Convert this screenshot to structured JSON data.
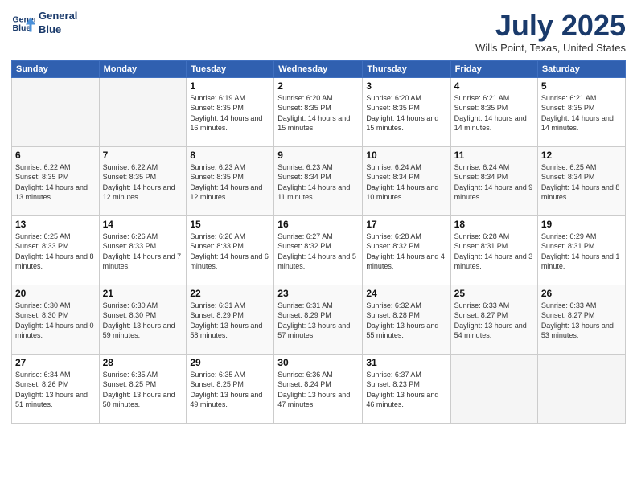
{
  "header": {
    "logo_line1": "General",
    "logo_line2": "Blue",
    "month_title": "July 2025",
    "location": "Wills Point, Texas, United States"
  },
  "weekdays": [
    "Sunday",
    "Monday",
    "Tuesday",
    "Wednesday",
    "Thursday",
    "Friday",
    "Saturday"
  ],
  "weeks": [
    [
      {
        "day": "",
        "info": ""
      },
      {
        "day": "",
        "info": ""
      },
      {
        "day": "1",
        "info": "Sunrise: 6:19 AM\nSunset: 8:35 PM\nDaylight: 14 hours and 16 minutes."
      },
      {
        "day": "2",
        "info": "Sunrise: 6:20 AM\nSunset: 8:35 PM\nDaylight: 14 hours and 15 minutes."
      },
      {
        "day": "3",
        "info": "Sunrise: 6:20 AM\nSunset: 8:35 PM\nDaylight: 14 hours and 15 minutes."
      },
      {
        "day": "4",
        "info": "Sunrise: 6:21 AM\nSunset: 8:35 PM\nDaylight: 14 hours and 14 minutes."
      },
      {
        "day": "5",
        "info": "Sunrise: 6:21 AM\nSunset: 8:35 PM\nDaylight: 14 hours and 14 minutes."
      }
    ],
    [
      {
        "day": "6",
        "info": "Sunrise: 6:22 AM\nSunset: 8:35 PM\nDaylight: 14 hours and 13 minutes."
      },
      {
        "day": "7",
        "info": "Sunrise: 6:22 AM\nSunset: 8:35 PM\nDaylight: 14 hours and 12 minutes."
      },
      {
        "day": "8",
        "info": "Sunrise: 6:23 AM\nSunset: 8:35 PM\nDaylight: 14 hours and 12 minutes."
      },
      {
        "day": "9",
        "info": "Sunrise: 6:23 AM\nSunset: 8:34 PM\nDaylight: 14 hours and 11 minutes."
      },
      {
        "day": "10",
        "info": "Sunrise: 6:24 AM\nSunset: 8:34 PM\nDaylight: 14 hours and 10 minutes."
      },
      {
        "day": "11",
        "info": "Sunrise: 6:24 AM\nSunset: 8:34 PM\nDaylight: 14 hours and 9 minutes."
      },
      {
        "day": "12",
        "info": "Sunrise: 6:25 AM\nSunset: 8:34 PM\nDaylight: 14 hours and 8 minutes."
      }
    ],
    [
      {
        "day": "13",
        "info": "Sunrise: 6:25 AM\nSunset: 8:33 PM\nDaylight: 14 hours and 8 minutes."
      },
      {
        "day": "14",
        "info": "Sunrise: 6:26 AM\nSunset: 8:33 PM\nDaylight: 14 hours and 7 minutes."
      },
      {
        "day": "15",
        "info": "Sunrise: 6:26 AM\nSunset: 8:33 PM\nDaylight: 14 hours and 6 minutes."
      },
      {
        "day": "16",
        "info": "Sunrise: 6:27 AM\nSunset: 8:32 PM\nDaylight: 14 hours and 5 minutes."
      },
      {
        "day": "17",
        "info": "Sunrise: 6:28 AM\nSunset: 8:32 PM\nDaylight: 14 hours and 4 minutes."
      },
      {
        "day": "18",
        "info": "Sunrise: 6:28 AM\nSunset: 8:31 PM\nDaylight: 14 hours and 3 minutes."
      },
      {
        "day": "19",
        "info": "Sunrise: 6:29 AM\nSunset: 8:31 PM\nDaylight: 14 hours and 1 minute."
      }
    ],
    [
      {
        "day": "20",
        "info": "Sunrise: 6:30 AM\nSunset: 8:30 PM\nDaylight: 14 hours and 0 minutes."
      },
      {
        "day": "21",
        "info": "Sunrise: 6:30 AM\nSunset: 8:30 PM\nDaylight: 13 hours and 59 minutes."
      },
      {
        "day": "22",
        "info": "Sunrise: 6:31 AM\nSunset: 8:29 PM\nDaylight: 13 hours and 58 minutes."
      },
      {
        "day": "23",
        "info": "Sunrise: 6:31 AM\nSunset: 8:29 PM\nDaylight: 13 hours and 57 minutes."
      },
      {
        "day": "24",
        "info": "Sunrise: 6:32 AM\nSunset: 8:28 PM\nDaylight: 13 hours and 55 minutes."
      },
      {
        "day": "25",
        "info": "Sunrise: 6:33 AM\nSunset: 8:27 PM\nDaylight: 13 hours and 54 minutes."
      },
      {
        "day": "26",
        "info": "Sunrise: 6:33 AM\nSunset: 8:27 PM\nDaylight: 13 hours and 53 minutes."
      }
    ],
    [
      {
        "day": "27",
        "info": "Sunrise: 6:34 AM\nSunset: 8:26 PM\nDaylight: 13 hours and 51 minutes."
      },
      {
        "day": "28",
        "info": "Sunrise: 6:35 AM\nSunset: 8:25 PM\nDaylight: 13 hours and 50 minutes."
      },
      {
        "day": "29",
        "info": "Sunrise: 6:35 AM\nSunset: 8:25 PM\nDaylight: 13 hours and 49 minutes."
      },
      {
        "day": "30",
        "info": "Sunrise: 6:36 AM\nSunset: 8:24 PM\nDaylight: 13 hours and 47 minutes."
      },
      {
        "day": "31",
        "info": "Sunrise: 6:37 AM\nSunset: 8:23 PM\nDaylight: 13 hours and 46 minutes."
      },
      {
        "day": "",
        "info": ""
      },
      {
        "day": "",
        "info": ""
      }
    ]
  ]
}
